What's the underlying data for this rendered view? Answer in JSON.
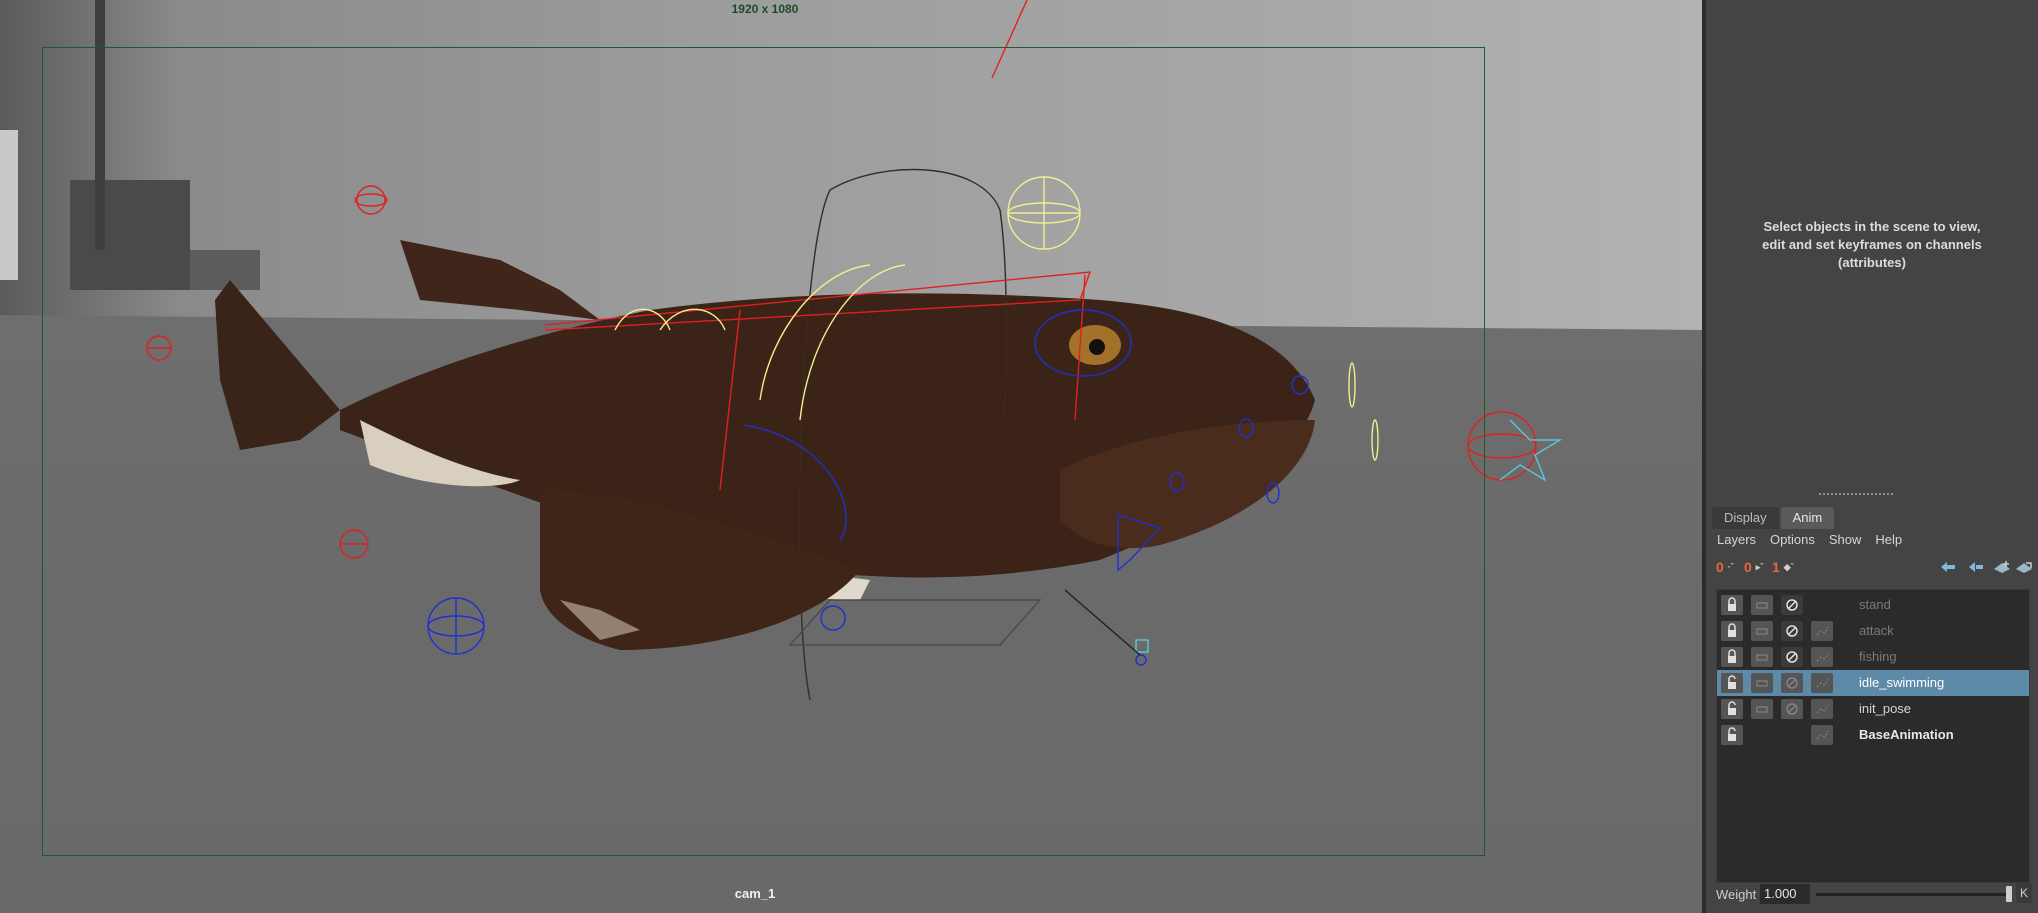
{
  "viewport": {
    "resolution_label": "1920 x 1080",
    "camera_name": "cam_1"
  },
  "channel_box": {
    "hint": "Select objects in the scene to view, edit and set keyframes on channels (attributes)"
  },
  "layer_editor": {
    "tabs": [
      {
        "label": "Display",
        "active": false
      },
      {
        "label": "Anim",
        "active": true
      }
    ],
    "menu": [
      "Layers",
      "Options",
      "Show",
      "Help"
    ],
    "toolbar": {
      "buttons": [
        {
          "label": "0",
          "icon": "layer-zero-key-icon"
        },
        {
          "label": "0",
          "icon": "layer-zero-weight-icon"
        },
        {
          "label": "1",
          "icon": "layer-full-weight-icon"
        }
      ],
      "right_icons": [
        "move-layer-up-icon",
        "move-layer-down-icon",
        "create-empty-layer-icon",
        "create-layer-from-selected-icon"
      ]
    },
    "layers": [
      {
        "name": "stand",
        "locked": true,
        "state": "muted"
      },
      {
        "name": "attack",
        "locked": true,
        "state": "muted"
      },
      {
        "name": "fishing",
        "locked": true,
        "state": "muted"
      },
      {
        "name": "idle_swimming",
        "locked": false,
        "state": "selected"
      },
      {
        "name": "init_pose",
        "locked": false,
        "state": "active"
      },
      {
        "name": "BaseAnimation",
        "locked": false,
        "state": "base"
      }
    ],
    "weight": {
      "label": "Weight",
      "value": "1.000",
      "fraction": 1.0,
      "key_label": "K"
    }
  },
  "colors": {
    "selection": "#5d8aa8",
    "accent_orange": "#e06a3a",
    "gate_border": "#1e5a2e"
  }
}
